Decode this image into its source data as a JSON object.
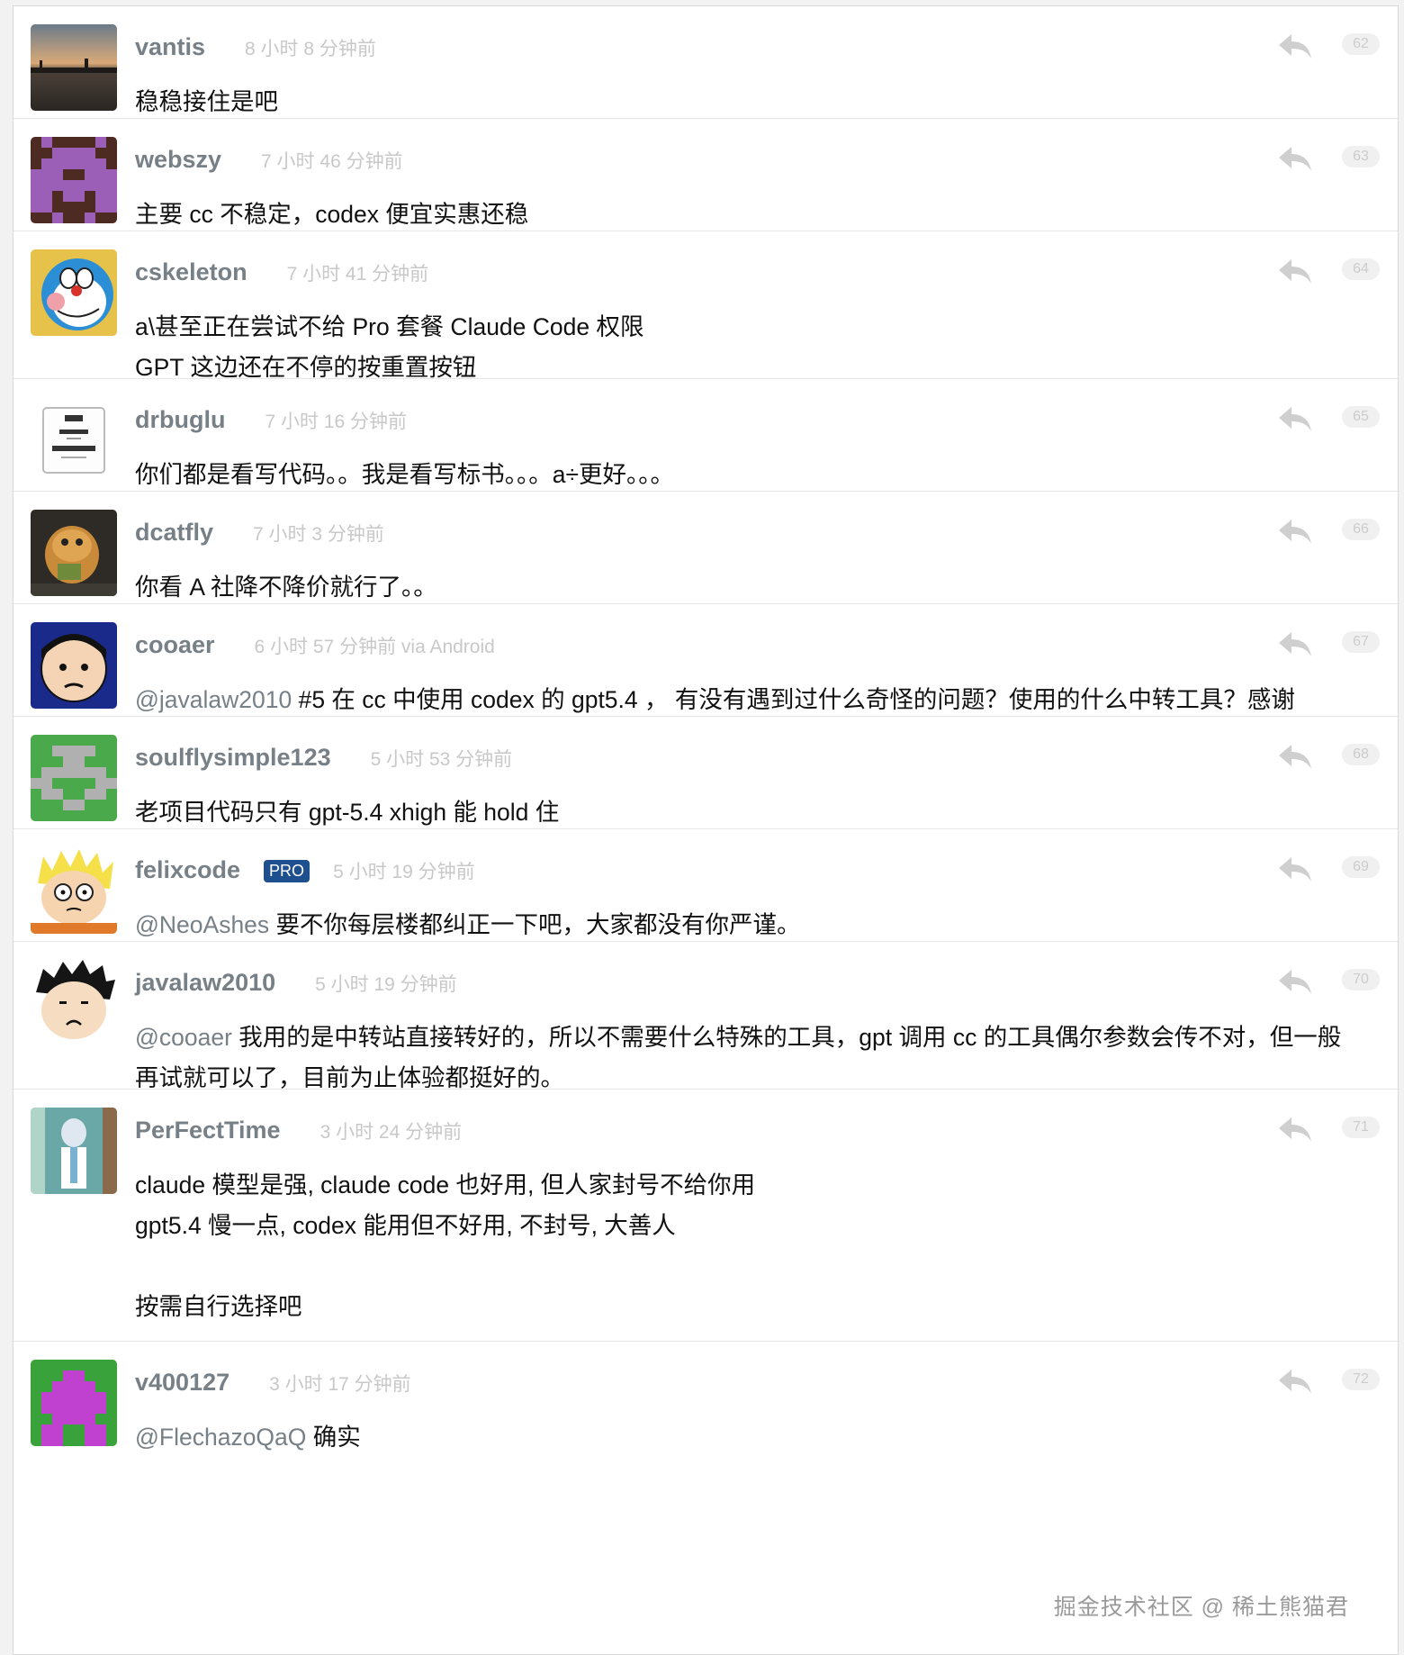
{
  "replies": [
    {
      "username": "vantis",
      "time": "8 小时 8 分钟前",
      "floor": "62",
      "lines": [
        "稳稳接住是吧"
      ]
    },
    {
      "username": "webszy",
      "time": "7 小时 46 分钟前",
      "floor": "63",
      "lines": [
        "主要 cc 不稳定，codex 便宜实惠还稳"
      ]
    },
    {
      "username": "cskeleton",
      "time": "7 小时 41 分钟前",
      "floor": "64",
      "lines": [
        "a\\甚至正在尝试不给 Pro 套餐 Claude Code 权限",
        "GPT 这边还在不停的按重置按钮"
      ]
    },
    {
      "username": "drbuglu",
      "time": "7 小时 16 分钟前",
      "floor": "65",
      "lines": [
        "你们都是看写代码。。我是看写标书。。。a÷更好。。。"
      ]
    },
    {
      "username": "dcatfly",
      "time": "7 小时 3 分钟前",
      "floor": "66",
      "lines": [
        "你看 A 社降不降价就行了。。"
      ]
    },
    {
      "username": "cooaer",
      "time": "6 小时 57 分钟前 via Android",
      "floor": "67",
      "mention": "@javalaw2010",
      "text": " #5 在 cc 中使用 codex 的 gpt5.4 ， 有没有遇到过什么奇怪的问题？使用的什么中转工具？感谢"
    },
    {
      "username": "soulflysimple123",
      "time": "5 小时 53 分钟前",
      "floor": "68",
      "lines": [
        "老项目代码只有 gpt-5.4 xhigh 能 hold 住"
      ]
    },
    {
      "username": "felixcode",
      "badge": "PRO",
      "time": "5 小时 19 分钟前",
      "floor": "69",
      "mention": "@NeoAshes",
      "text": " 要不你每层楼都纠正一下吧，大家都没有你严谨。"
    },
    {
      "username": "javalaw2010",
      "time": "5 小时 19 分钟前",
      "floor": "70",
      "mention": "@cooaer",
      "text": " 我用的是中转站直接转好的，所以不需要什么特殊的工具，gpt 调用 cc 的工具偶尔参数会传不对，但一般再试就可以了，目前为止体验都挺好的。"
    },
    {
      "username": "PerFectTime",
      "time": "3 小时 24 分钟前",
      "floor": "71",
      "lines": [
        "claude 模型是强, claude code 也好用, 但人家封号不给你用",
        "gpt5.4 慢一点, codex 能用但不好用, 不封号, 大善人",
        "",
        "按需自行选择吧"
      ]
    },
    {
      "username": "v400127",
      "time": "3 小时 17 分钟前",
      "floor": "72",
      "mention": "@FlechazoQaQ",
      "text": " 确实"
    }
  ],
  "watermark": "掘金技术社区 @ 稀土熊猫君",
  "colors": {
    "username": "#778087",
    "time": "#c8c8c8",
    "mention": "#778087",
    "pro_badge": "#1e4f8f",
    "divider": "#e6e6e6"
  },
  "icons": {
    "reply": "reply-arrow-icon"
  }
}
